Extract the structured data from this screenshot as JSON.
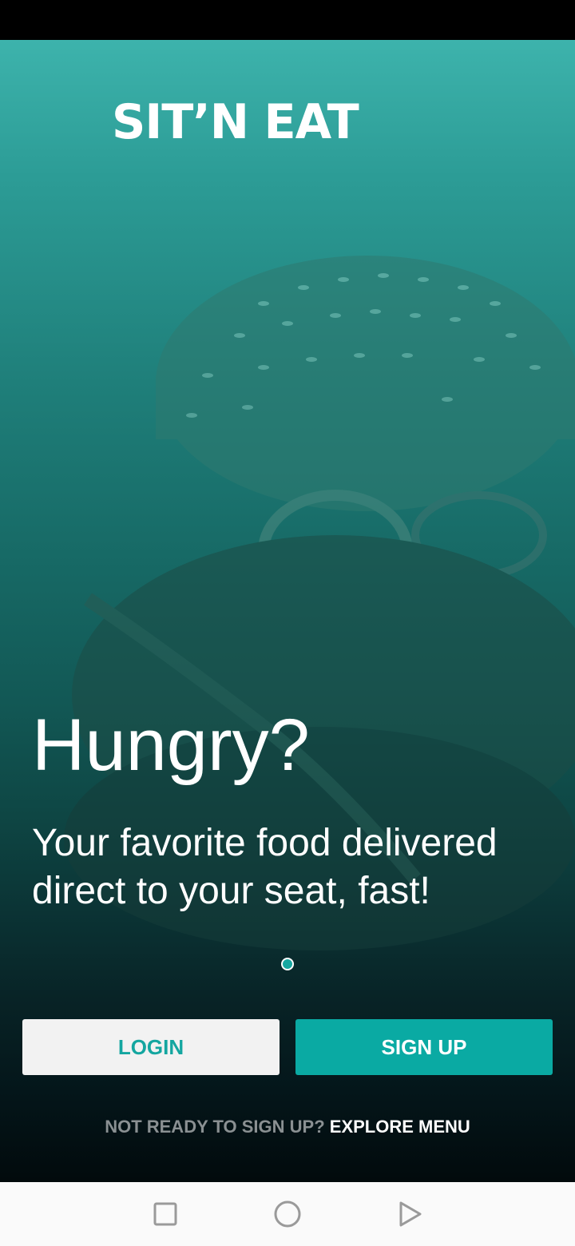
{
  "app": {
    "logo_text": "SIT’N EAT"
  },
  "hero": {
    "headline": "Hungry?",
    "subtitle": "Your favorite food delivered direct to your seat, fast!",
    "pager": {
      "pages": 1,
      "current": 1
    }
  },
  "actions": {
    "login_label": "LOGIN",
    "signup_label": "SIGN UP"
  },
  "explore": {
    "prompt": "NOT READY TO SIGN UP?",
    "link_label": "EXPLORE MENU"
  },
  "navigation_bar": {
    "buttons": [
      "recents-icon",
      "home-icon",
      "back-icon"
    ]
  },
  "colors": {
    "accent": "#0aaaa3",
    "login_bg": "#f2f2f2",
    "hero_top": "#3db3ac",
    "hero_bottom": "#020a0c"
  }
}
